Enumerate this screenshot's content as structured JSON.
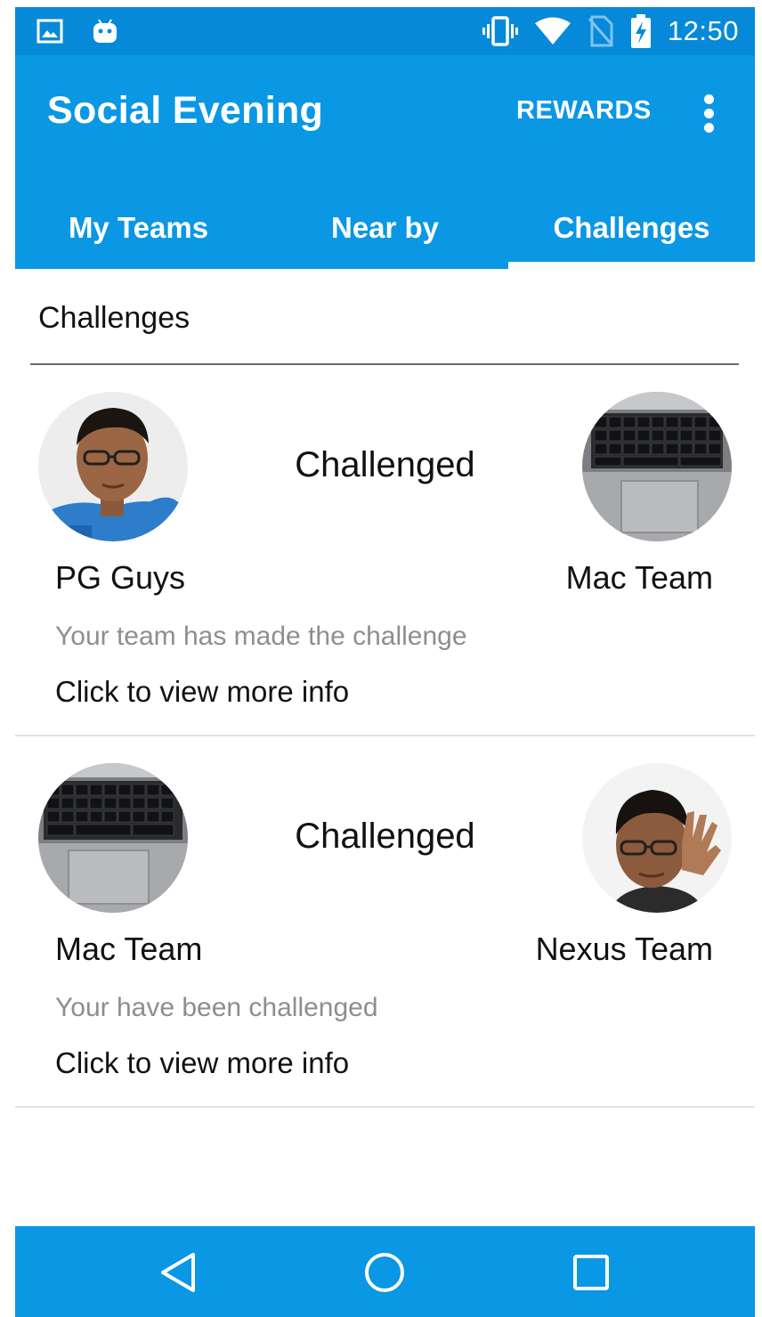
{
  "status_bar": {
    "time": "12:50",
    "left_icons": [
      "image-icon",
      "android-icon"
    ],
    "right_icons": [
      "vibrate-icon",
      "wifi-icon",
      "no-sim-icon",
      "battery-charging-icon"
    ]
  },
  "app_bar": {
    "title": "Social Evening",
    "rewards_label": "REWARDS",
    "overflow_icon": "more-vert-icon",
    "tabs": [
      {
        "label": "My Teams",
        "active": false
      },
      {
        "label": "Near by",
        "active": false
      },
      {
        "label": "Challenges",
        "active": true
      }
    ]
  },
  "section": {
    "header": "Challenges"
  },
  "challenges": [
    {
      "left_team": "PG Guys",
      "right_team": "Mac Team",
      "relation": "Challenged",
      "status": "Your team has made the challenge",
      "link": "Click to view more info",
      "left_avatar": "person-avatar",
      "right_avatar": "keyboard-avatar"
    },
    {
      "left_team": "Mac Team",
      "right_team": "Nexus Team",
      "relation": "Challenged",
      "status": "Your have been challenged",
      "link": "Click to view more info",
      "left_avatar": "keyboard-avatar",
      "right_avatar": "person-waving-avatar"
    }
  ],
  "nav_bar": {
    "buttons": [
      "back-icon",
      "home-icon",
      "recents-icon"
    ]
  },
  "colors": {
    "status_bar": "#0689D8",
    "primary": "#0A97E4",
    "text_primary": "#111111",
    "text_secondary": "#8E8E8E",
    "divider": "#E2E2E2"
  }
}
